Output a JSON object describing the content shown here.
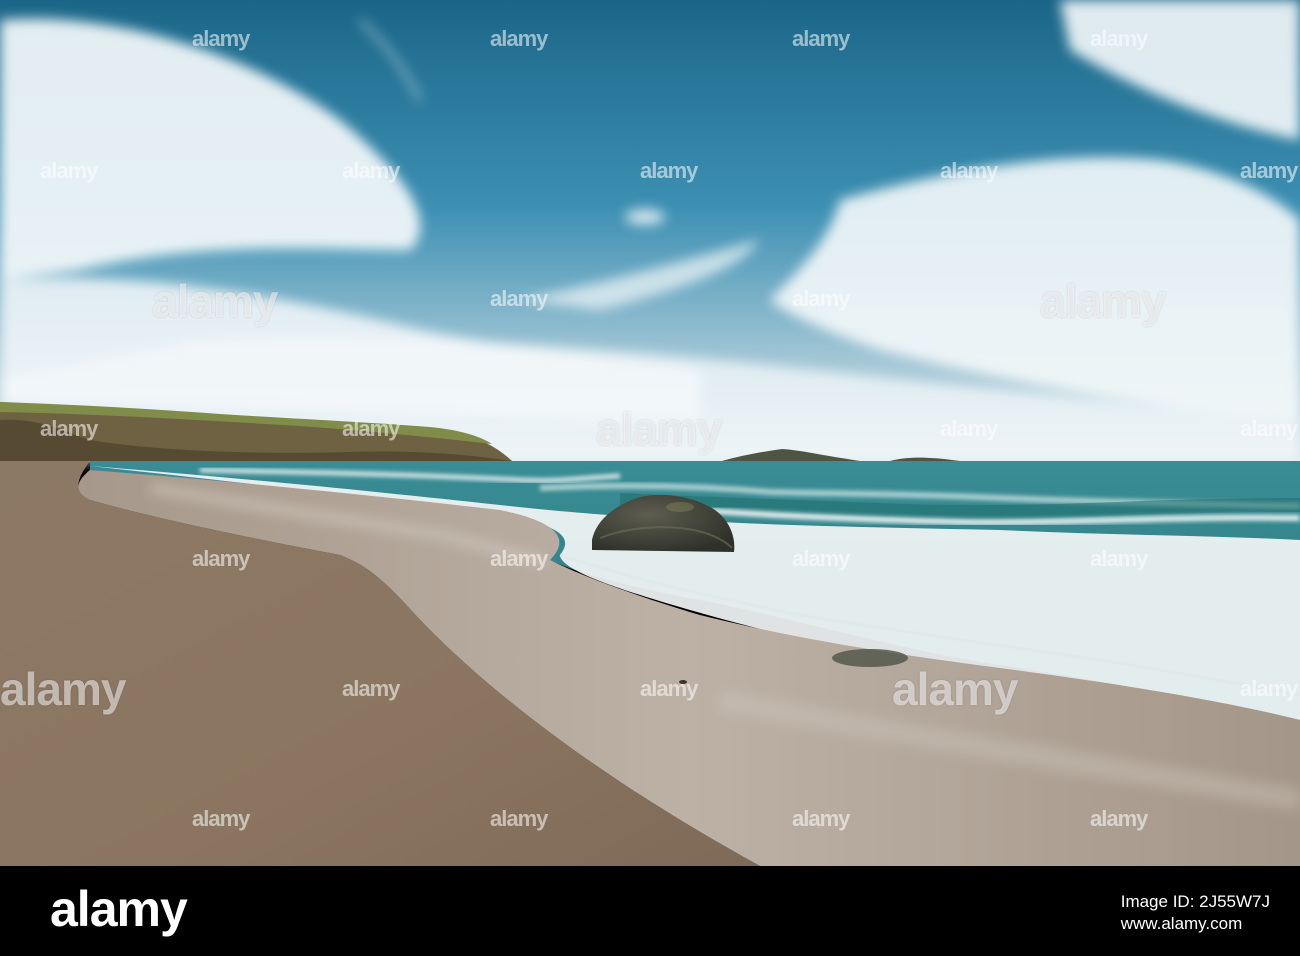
{
  "image": {
    "subject": "Sandy beach with breaking waves, a large rock in the surf, headland and small islands under a blue cloudy sky",
    "colors": {
      "sky_top": "#1f6f8f",
      "sky_mid": "#4a9cbc",
      "cloud": "#f2f6f8",
      "sea": "#2f8a8a",
      "foam": "#f5f8f8",
      "sand_dry": "#8a7560",
      "sand_wet": "#b7a898",
      "headland": "#6b6040",
      "grass": "#7d8a48",
      "rock": "#3e3f36",
      "footer_bg": "#000000"
    }
  },
  "watermark": {
    "text": "alamy"
  },
  "footer": {
    "logo": "alamy",
    "image_id_line": "Image ID: 2J55W7J",
    "site_line": "www.alamy.com"
  }
}
